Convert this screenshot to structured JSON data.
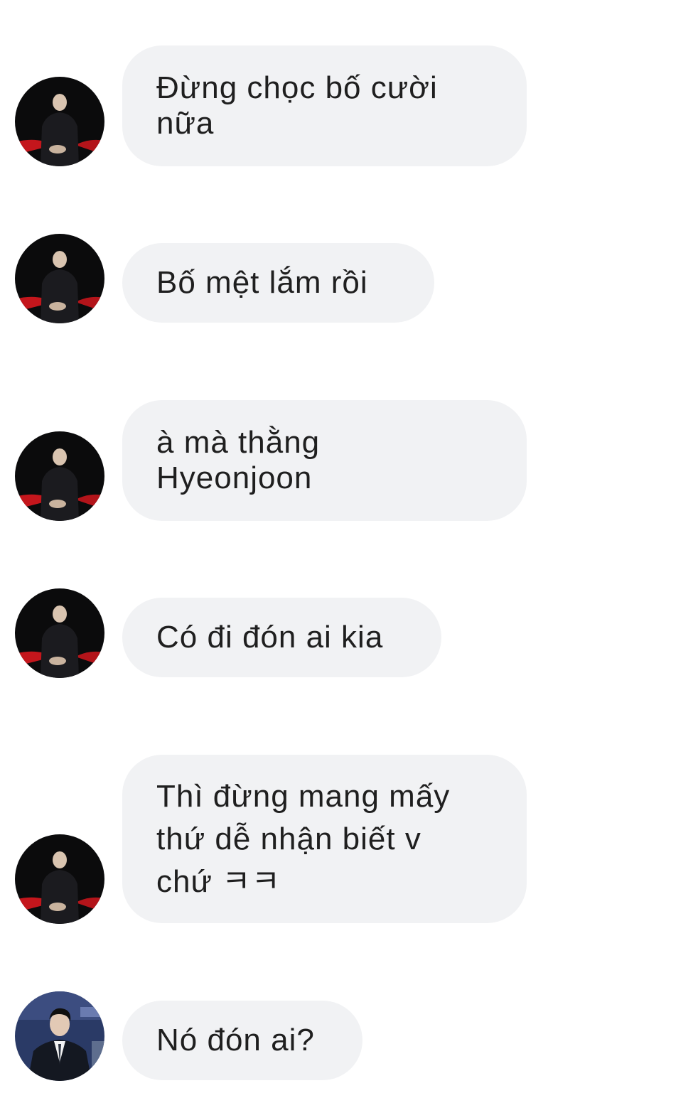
{
  "messages": [
    {
      "sender": "father",
      "avatar_icon": "person-dark-avatar-icon",
      "lines": [
        "Đừng chọc bố cười",
        "nữa"
      ]
    },
    {
      "sender": "father",
      "avatar_icon": "person-dark-avatar-icon",
      "lines": [
        "Bố mệt lắm rồi"
      ]
    },
    {
      "sender": "father",
      "avatar_icon": "person-dark-avatar-icon",
      "lines": [
        "à mà thằng",
        "Hyeonjoon"
      ]
    },
    {
      "sender": "father",
      "avatar_icon": "person-dark-avatar-icon",
      "lines": [
        "Có đi đón ai kia"
      ]
    },
    {
      "sender": "father",
      "avatar_icon": "person-dark-avatar-icon",
      "lines": [
        "Thì đừng mang mấy",
        "thứ dễ nhận biết v",
        "chứ ㅋㅋ"
      ]
    },
    {
      "sender": "other",
      "avatar_icon": "person-suit-avatar-icon",
      "lines": [
        "Nó đón ai?"
      ]
    }
  ],
  "colors": {
    "bubble_bg": "#f1f2f4",
    "text": "#1f1f1f",
    "background": "#ffffff"
  }
}
